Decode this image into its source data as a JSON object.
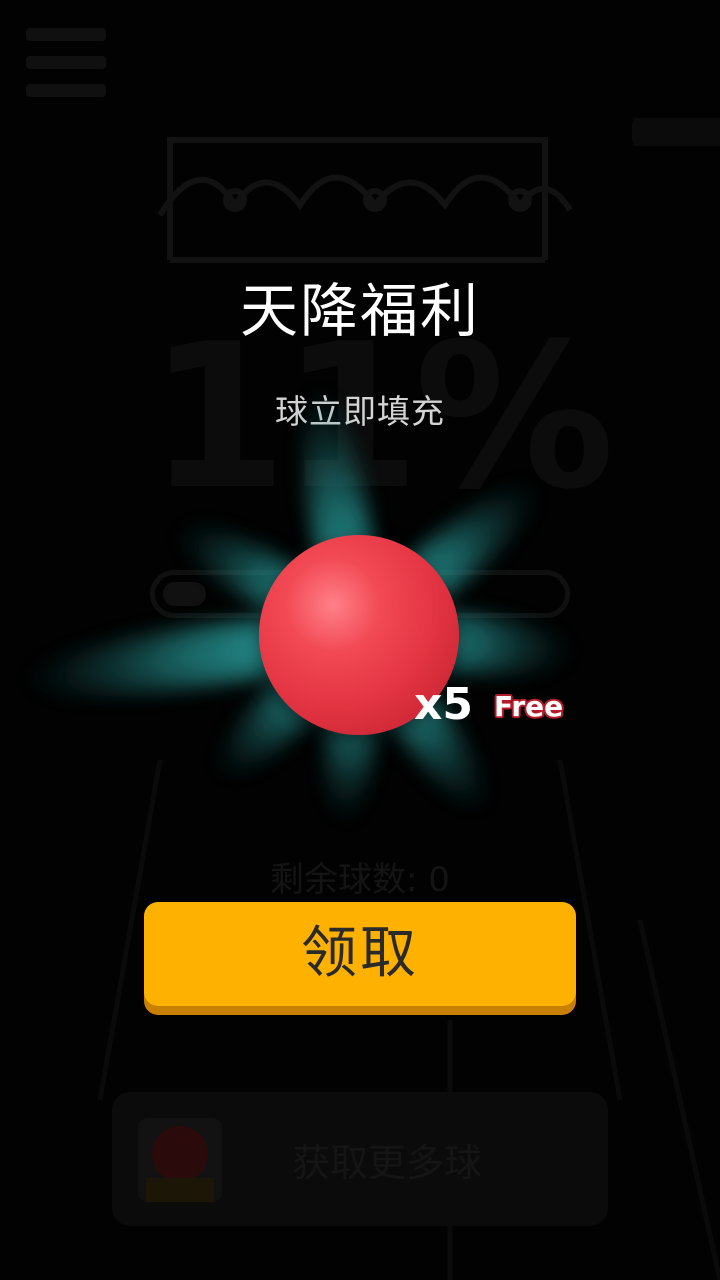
{
  "background": {
    "progress_percent_text": "11%",
    "progress_value": 0.11,
    "remaining_balls_text": "剩余球数: 0",
    "get_more_balls_label": "获取更多球",
    "icons": [
      "menu-icon",
      "crown-icon",
      "ball-icon"
    ]
  },
  "popup": {
    "title": "天降福利",
    "subtitle": "球立即填充",
    "reward": {
      "multiplier": "x5",
      "tag": "Free",
      "icon": "red-ball-icon"
    },
    "claim_label": "领取"
  },
  "colors": {
    "button": "#ffb100",
    "button_shadow": "#c97f00",
    "ball": "#e43543",
    "burst": "#39c9c7",
    "free_outline": "#b51c2a"
  }
}
